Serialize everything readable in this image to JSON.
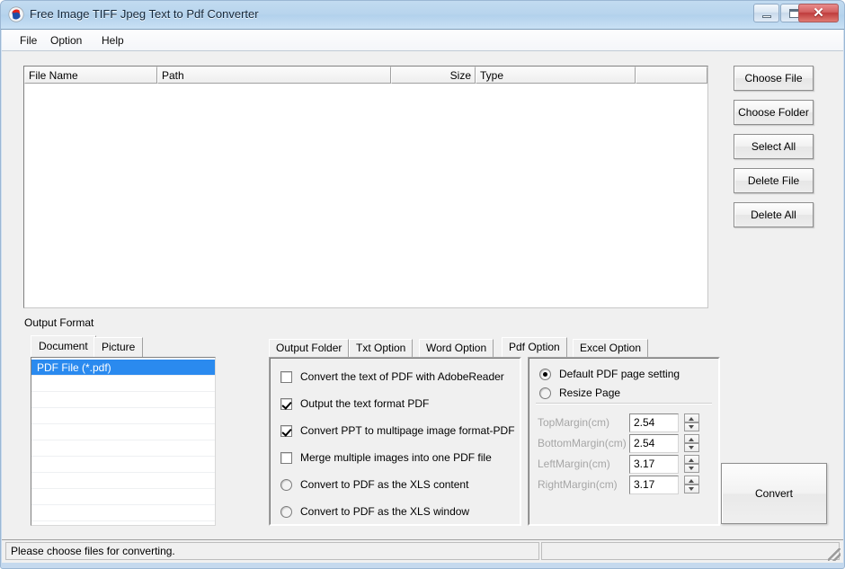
{
  "window": {
    "title": "Free Image TIFF Jpeg Text to Pdf Converter",
    "icon": "app-logo-icon",
    "controls": {
      "minimize": "minimize-icon",
      "maximize": "maximize-icon",
      "close": "✕"
    }
  },
  "menubar": {
    "items": [
      {
        "label": "File"
      },
      {
        "label": "Option"
      },
      {
        "label": "Help"
      }
    ]
  },
  "filelist": {
    "columns": [
      {
        "label": "File Name"
      },
      {
        "label": "Path"
      },
      {
        "label": "Size"
      },
      {
        "label": "Type"
      },
      {
        "label": ""
      }
    ],
    "rows": []
  },
  "side_buttons": [
    {
      "label": "Choose File"
    },
    {
      "label": "Choose Folder"
    },
    {
      "label": "Select All"
    },
    {
      "label": "Delete File"
    },
    {
      "label": "Delete All"
    }
  ],
  "output_format": {
    "label": "Output Format",
    "tabs": [
      {
        "label": "Document",
        "selected": true
      },
      {
        "label": "Picture",
        "selected": false
      }
    ],
    "list": [
      {
        "label": "PDF File  (*.pdf)",
        "selected": true
      }
    ]
  },
  "option_tabs": [
    {
      "label": "Output Folder",
      "selected": false
    },
    {
      "label": "Txt Option",
      "selected": false
    },
    {
      "label": "Word Option",
      "selected": false
    },
    {
      "label": "Pdf Option",
      "selected": true
    },
    {
      "label": "Excel Option",
      "selected": false
    }
  ],
  "pdf_option": {
    "checkboxes": [
      {
        "label": "Convert the text of PDF with AdobeReader",
        "checked": false
      },
      {
        "label": "Output the text format PDF",
        "checked": true
      },
      {
        "label": "Convert PPT to multipage image format-PDF",
        "checked": true
      },
      {
        "label": "Merge multiple images into one PDF file",
        "checked": false
      }
    ],
    "radios": [
      {
        "label": "Convert to PDF as the XLS content",
        "checked": false
      },
      {
        "label": "Convert to PDF as the XLS window",
        "checked": false
      }
    ],
    "page_setting": {
      "radios": [
        {
          "label": "Default PDF page setting",
          "checked": true
        },
        {
          "label": "Resize Page",
          "checked": false
        }
      ],
      "margins": [
        {
          "label": "TopMargin(cm)",
          "value": "2.54",
          "disabled": true
        },
        {
          "label": "BottomMargin(cm)",
          "value": "2.54",
          "disabled": true
        },
        {
          "label": "LeftMargin(cm)",
          "value": "3.17",
          "disabled": true
        },
        {
          "label": "RightMargin(cm)",
          "value": "3.17",
          "disabled": true
        }
      ]
    }
  },
  "convert_button": {
    "label": "Convert"
  },
  "statusbar": {
    "message": "Please choose files for converting.",
    "second_panel": ""
  },
  "colors": {
    "titlebar": "#b7d4ed",
    "selection": "#2a8aef",
    "close_button": "#bf3c3c",
    "client_bg": "#f0f0f0",
    "disabled_text": "#a6a6a6"
  }
}
